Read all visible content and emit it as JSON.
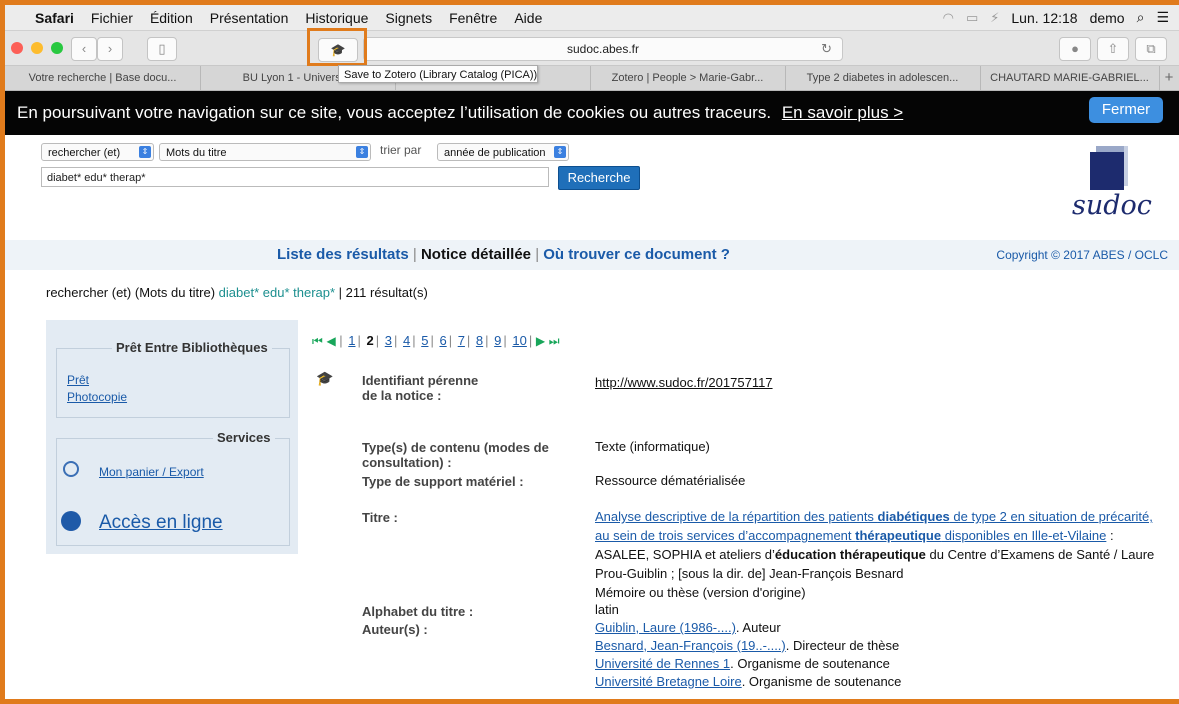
{
  "menubar": {
    "apple": "",
    "items": [
      "Safari",
      "Fichier",
      "Édition",
      "Présentation",
      "Historique",
      "Signets",
      "Fenêtre",
      "Aide"
    ],
    "clock": "Lun. 12:18",
    "user": "demo"
  },
  "toolbar": {
    "address": "sudoc.abes.fr"
  },
  "tooltip": "Save to Zotero (Library Catalog (PICA))",
  "tabs": [
    "Votre recherche | Base docu...",
    "BU Lyon 1 - Université",
    "",
    "Zotero | People > Marie-Gabr...",
    "Type 2 diabetes in adolescen...",
    "CHAUTARD MARIE-GABRIEL..."
  ],
  "cookie": {
    "text": "En poursuivant votre navigation sur ce site, vous acceptez l’utilisation de cookies ou autres traceurs.",
    "link": "En savoir plus >",
    "close": "Fermer"
  },
  "search": {
    "mode": "rechercher (et)",
    "field": "Mots du titre",
    "sort_label": "trier par",
    "sort": "année de publication",
    "query": "diabet* edu* therap*",
    "button": "Recherche"
  },
  "logo_text": "sudoc",
  "nav": {
    "results": "Liste des résultats",
    "notice": "Notice détaillée",
    "where": "Où trouver ce document ?",
    "copyright": "Copyright © 2017 ABES / OCLC"
  },
  "summary": {
    "prefix": "rechercher (et) (Mots du titre)",
    "query": "diabet* edu* therap*",
    "count": "211 résultat(s)"
  },
  "sidebar": {
    "peb_title": "Prêt Entre Bibliothèques",
    "pret": "Prêt",
    "photocopie": "Photocopie",
    "services_title": "Services",
    "panier": "Mon panier / Export",
    "acces": "Accès en ligne"
  },
  "pager": {
    "pages": [
      "1",
      "2",
      "3",
      "4",
      "5",
      "6",
      "7",
      "8",
      "9",
      "10"
    ],
    "current": "2"
  },
  "record": {
    "id_label_1": "Identifiant pérenne",
    "id_label_2": "de la notice :",
    "id_value": "http://www.sudoc.fr/201757117",
    "content_label_1": "Type(s) de contenu (modes de",
    "content_label_2": "consultation) :",
    "content_value": "Texte (informatique)",
    "support_label": "Type de support matériel :",
    "support_value": "Ressource dématérialisée",
    "title_label": "Titre :",
    "title_link_1": "Analyse descriptive de la répartition des patients ",
    "title_hl_1": "diabétiques",
    "title_link_2": " de type 2 en situation de précarité, au sein de trois services d’accompagnement ",
    "title_hl_2": "thérapeutique",
    "title_link_3": " disponibles en Ille-et-Vilaine",
    "title_rest_1": " : ASALEE, SOPHIA et ateliers d’",
    "title_hl_3": "éducation thérapeutique",
    "title_rest_2": " du Centre d’Examens de Santé / Laure Prou-Guiblin ; [sous la dir. de] Jean-François Besnard",
    "title_note": "Mémoire ou thèse (version d'origine)",
    "alphabet_label": "Alphabet du titre :",
    "alphabet_value": "latin",
    "authors_label": "Auteur(s) :",
    "authors": [
      {
        "name": "Guiblin, Laure (1986-....)",
        "role": ". Auteur"
      },
      {
        "name": "Besnard, Jean-François (19..-....)",
        "role": ". Directeur de thèse"
      },
      {
        "name": "Université de Rennes 1",
        "role": ". Organisme de soutenance"
      },
      {
        "name": "Université Bretagne Loire",
        "role": ". Organisme de soutenance"
      }
    ]
  },
  "colors": {
    "highlight_frame": "#e07b1c",
    "cookie_bg": "#050505",
    "link": "#1a5aa8",
    "button": "#1f6fb9"
  }
}
